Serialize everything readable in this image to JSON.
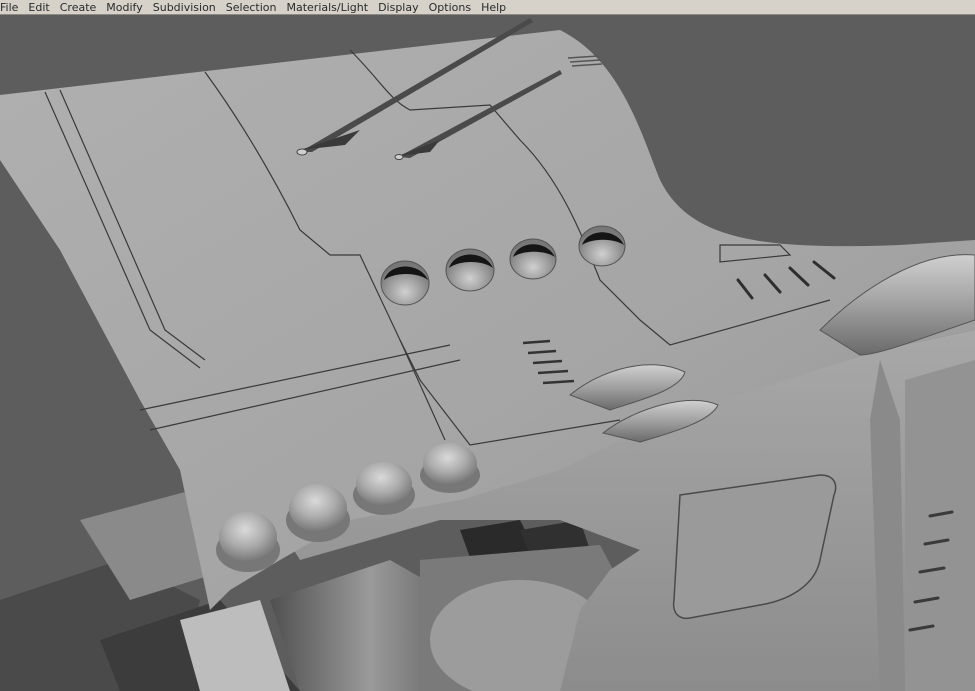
{
  "menubar": {
    "items": [
      "File",
      "Edit",
      "Create",
      "Modify",
      "Subdivision",
      "Selection",
      "Materials/Light",
      "Display",
      "Options",
      "Help"
    ]
  },
  "viewport": {
    "background_color": "#5d5d5d",
    "model_color": "#a6a6a6",
    "shading": "smooth-shaded grey"
  }
}
